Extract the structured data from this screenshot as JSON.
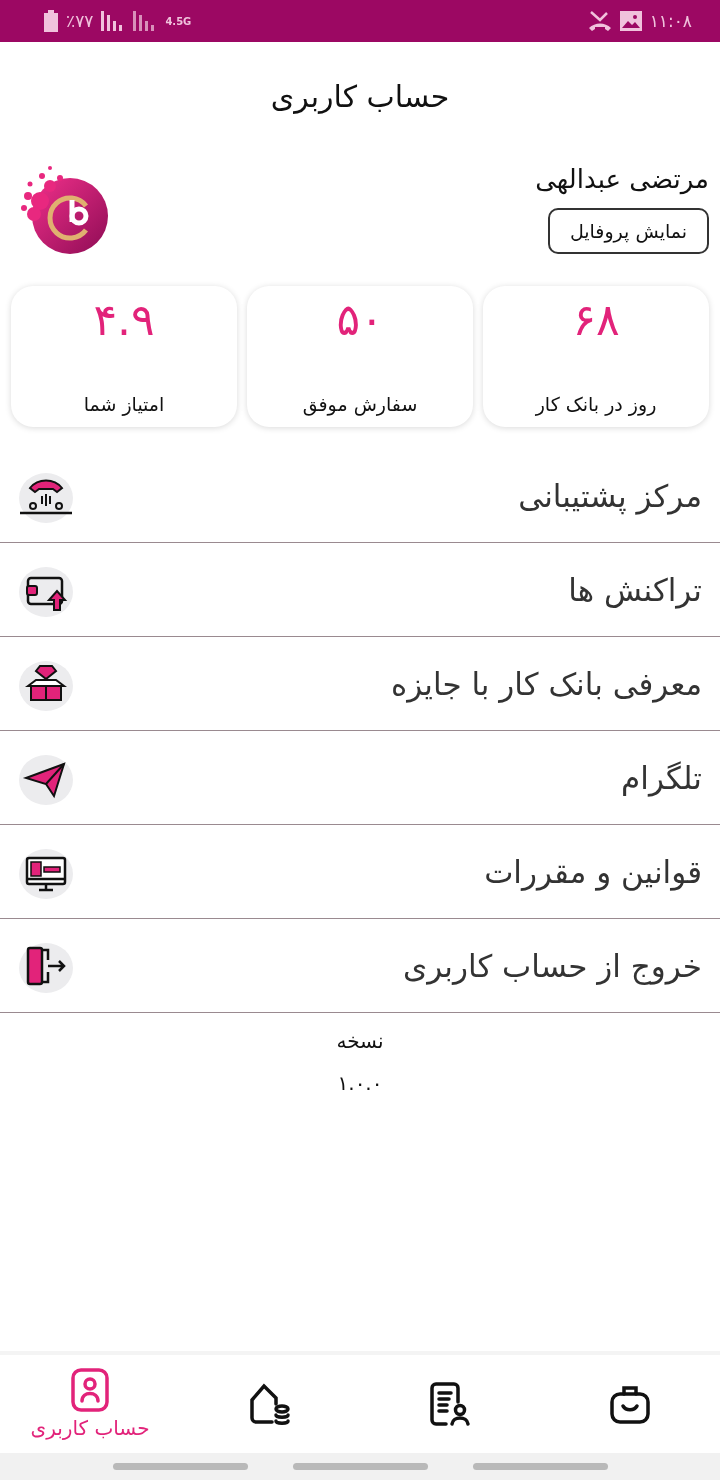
{
  "status_bar": {
    "battery": "٪۷۷",
    "network": "4.5G",
    "time": "۱۱:۰۸"
  },
  "header": {
    "title": "حساب کاربری"
  },
  "profile": {
    "name": "مرتضی عبدالهی",
    "button": "نمایش پروفایل"
  },
  "stats": [
    {
      "value": "۶۸",
      "label": "روز در بانک کار"
    },
    {
      "value": "۵۰",
      "label": "سفارش موفق"
    },
    {
      "value": "۴.۹",
      "label": "امتیاز شما"
    }
  ],
  "menu": [
    {
      "label": "مرکز پشتیبانی"
    },
    {
      "label": "تراکنش ها"
    },
    {
      "label": "معرفی بانک کار با جایزه"
    },
    {
      "label": "تلگرام"
    },
    {
      "label": "قوانین و مقررات"
    },
    {
      "label": "خروج از حساب کاربری"
    }
  ],
  "version": {
    "label": "نسخه",
    "number": "۱.۰.۰"
  },
  "bottom_nav": [
    {
      "selected": false
    },
    {
      "selected": false
    },
    {
      "selected": false
    },
    {
      "label": "حساب کاربری",
      "selected": true
    }
  ]
}
